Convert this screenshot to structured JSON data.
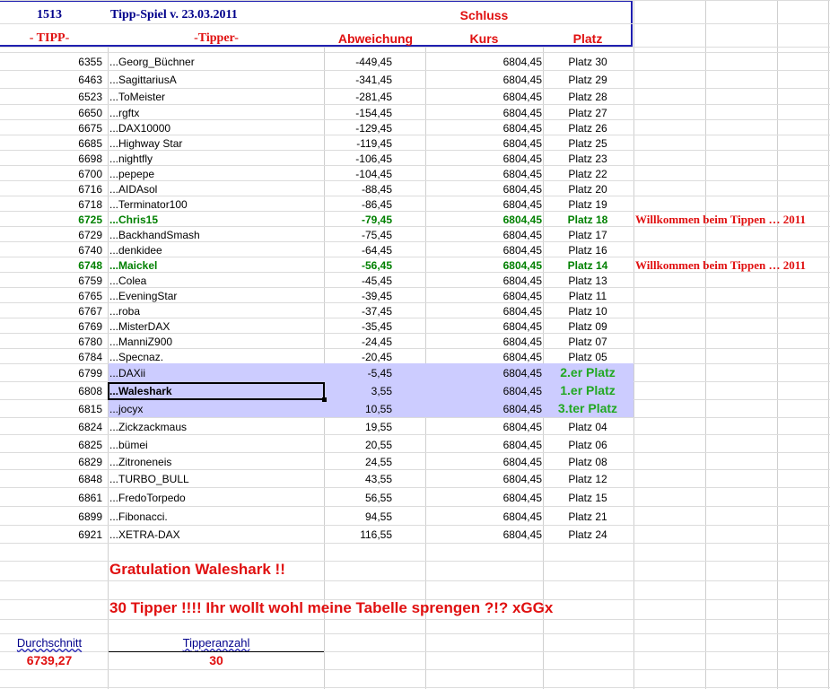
{
  "header": {
    "tipp_number": "1513",
    "title": "Tipp-Spiel v. 23.03.2011",
    "schluss": "Schluss",
    "col_tipp": "- TIPP-",
    "col_tipper": "-Tipper-",
    "col_abweichung": "Abweichung",
    "col_kurs": "Kurs",
    "col_platz": "Platz"
  },
  "rows": [
    {
      "tipp": "6355",
      "name": "...Georg_Büchner",
      "abw": "-449,45",
      "kurs": "6804,45",
      "platz": "Platz 30",
      "note": ""
    },
    {
      "tipp": "6463",
      "name": "...SagittariusA",
      "abw": "-341,45",
      "kurs": "6804,45",
      "platz": "Platz 29",
      "note": ""
    },
    {
      "tipp": "6523",
      "name": "...ToMeister",
      "abw": "-281,45",
      "kurs": "6804,45",
      "platz": "Platz 28",
      "note": ""
    },
    {
      "tipp": "6650",
      "name": "...rgftx",
      "abw": "-154,45",
      "kurs": "6804,45",
      "platz": "Platz 27",
      "note": ""
    },
    {
      "tipp": "6675",
      "name": "...DAX10000",
      "abw": "-129,45",
      "kurs": "6804,45",
      "platz": "Platz 26",
      "note": ""
    },
    {
      "tipp": "6685",
      "name": "...Highway Star",
      "abw": "-119,45",
      "kurs": "6804,45",
      "platz": "Platz 25",
      "note": ""
    },
    {
      "tipp": "6698",
      "name": "...nightfly",
      "abw": "-106,45",
      "kurs": "6804,45",
      "platz": "Platz 23",
      "note": ""
    },
    {
      "tipp": "6700",
      "name": "...pepepe",
      "abw": "-104,45",
      "kurs": "6804,45",
      "platz": "Platz 22",
      "note": ""
    },
    {
      "tipp": "6716",
      "name": "...AIDAsol",
      "abw": "-88,45",
      "kurs": "6804,45",
      "platz": "Platz 20",
      "note": ""
    },
    {
      "tipp": "6718",
      "name": "...Terminator100",
      "abw": "-86,45",
      "kurs": "6804,45",
      "platz": "Platz 19",
      "note": ""
    },
    {
      "tipp": "6725",
      "name": "...Chris15",
      "abw": "-79,45",
      "kurs": "6804,45",
      "platz": "Platz 18",
      "note": "Willkommen beim Tippen … 2011"
    },
    {
      "tipp": "6729",
      "name": "...BackhandSmash",
      "abw": "-75,45",
      "kurs": "6804,45",
      "platz": "Platz 17",
      "note": ""
    },
    {
      "tipp": "6740",
      "name": "...denkidee",
      "abw": "-64,45",
      "kurs": "6804,45",
      "platz": "Platz 16",
      "note": ""
    },
    {
      "tipp": "6748",
      "name": "...Maickel",
      "abw": "-56,45",
      "kurs": "6804,45",
      "platz": "Platz 14",
      "note": "Willkommen beim Tippen … 2011"
    },
    {
      "tipp": "6759",
      "name": "...Colea",
      "abw": "-45,45",
      "kurs": "6804,45",
      "platz": "Platz 13",
      "note": ""
    },
    {
      "tipp": "6765",
      "name": "...EveningStar",
      "abw": "-39,45",
      "kurs": "6804,45",
      "platz": "Platz 11",
      "note": ""
    },
    {
      "tipp": "6767",
      "name": "...roba",
      "abw": "-37,45",
      "kurs": "6804,45",
      "platz": "Platz 10",
      "note": ""
    },
    {
      "tipp": "6769",
      "name": "...MisterDAX",
      "abw": "-35,45",
      "kurs": "6804,45",
      "platz": "Platz 09",
      "note": ""
    },
    {
      "tipp": "6780",
      "name": "...ManniZ900",
      "abw": "-24,45",
      "kurs": "6804,45",
      "platz": "Platz 07",
      "note": ""
    },
    {
      "tipp": "6784",
      "name": "...Specnaz.",
      "abw": "-20,45",
      "kurs": "6804,45",
      "platz": "Platz 05",
      "note": ""
    },
    {
      "tipp": "6799",
      "name": "...DAXii",
      "abw": "-5,45",
      "kurs": "6804,45",
      "platz": "2.er Platz",
      "note": ""
    },
    {
      "tipp": "6808",
      "name": "...Waleshark",
      "abw": "3,55",
      "kurs": "6804,45",
      "platz": "1.er Platz",
      "note": ""
    },
    {
      "tipp": "6815",
      "name": "...jocyx",
      "abw": "10,55",
      "kurs": "6804,45",
      "platz": "3.ter Platz",
      "note": ""
    },
    {
      "tipp": "6824",
      "name": "...Zickzackmaus",
      "abw": "19,55",
      "kurs": "6804,45",
      "platz": "Platz 04",
      "note": ""
    },
    {
      "tipp": "6825",
      "name": "...bümei",
      "abw": "20,55",
      "kurs": "6804,45",
      "platz": "Platz 06",
      "note": ""
    },
    {
      "tipp": "6829",
      "name": "...Zitroneneis",
      "abw": "24,55",
      "kurs": "6804,45",
      "platz": "Platz 08",
      "note": ""
    },
    {
      "tipp": "6848",
      "name": "...TURBO_BULL",
      "abw": "43,55",
      "kurs": "6804,45",
      "platz": "Platz 12",
      "note": ""
    },
    {
      "tipp": "6861",
      "name": "...FredoTorpedo",
      "abw": "56,55",
      "kurs": "6804,45",
      "platz": "Platz 15",
      "note": ""
    },
    {
      "tipp": "6899",
      "name": "...Fibonacci.",
      "abw": "94,55",
      "kurs": "6804,45",
      "platz": "Platz 21",
      "note": ""
    },
    {
      "tipp": "6921",
      "name": "...XETRA-DAX",
      "abw": "116,55",
      "kurs": "6804,45",
      "platz": "Platz 24",
      "note": ""
    }
  ],
  "messages": {
    "gratulation": "Gratulation Waleshark !!",
    "tipper_msg": "30 Tipper !!!! Ihr wollt wohl meine Tabelle sprengen ?!? xGGx"
  },
  "footer": {
    "durchschnitt_label": "Durchschnitt",
    "durchschnitt_value": "6739,27",
    "tipperanzahl_label": "Tipperanzahl",
    "tipperanzahl_value": "30"
  },
  "colors": {
    "header_border": "#1f1fb0",
    "highlight": "#ccccff",
    "green": "#008000",
    "red": "#e01010",
    "navy": "#00008b"
  }
}
